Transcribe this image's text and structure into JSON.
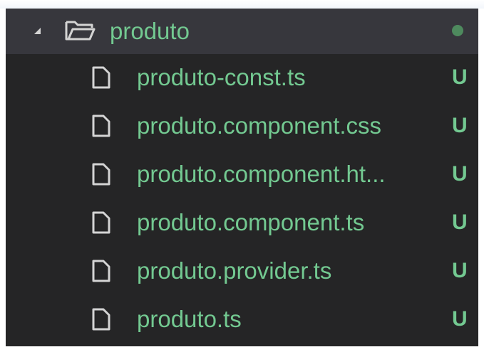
{
  "explorer": {
    "folder": {
      "name": "produto",
      "icon": "folder-open-icon",
      "twistie_icon": "chevron-expanded-icon",
      "has_changes_dot": true
    },
    "files": [
      {
        "name": "produto-const.ts",
        "status": "U",
        "icon": "file-icon"
      },
      {
        "name": "produto.component.css",
        "status": "U",
        "icon": "file-icon"
      },
      {
        "name": "produto.component.ht...",
        "status": "U",
        "icon": "file-icon"
      },
      {
        "name": "produto.component.ts",
        "status": "U",
        "icon": "file-icon"
      },
      {
        "name": "produto.provider.ts",
        "status": "U",
        "icon": "file-icon"
      },
      {
        "name": "produto.ts",
        "status": "U",
        "icon": "file-icon"
      }
    ]
  },
  "colors": {
    "background": "#252526",
    "selected_row": "#37373d",
    "untracked_green": "#73c991",
    "dot": "#4e8a5e",
    "icon_outline": "#d4d4d4"
  }
}
